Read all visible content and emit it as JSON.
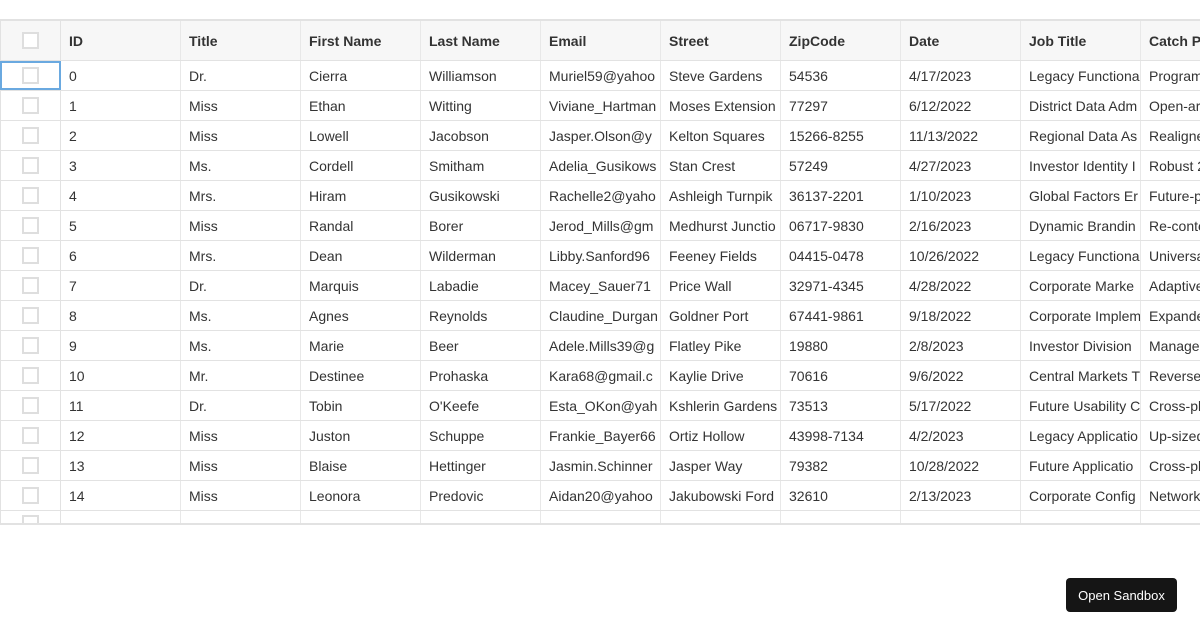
{
  "table": {
    "select_all_checked": false,
    "columns": [
      "ID",
      "Title",
      "First Name",
      "Last Name",
      "Email",
      "Street",
      "ZipCode",
      "Date",
      "Job Title",
      "Catch P"
    ],
    "rows": [
      [
        "0",
        "Dr.",
        "Cierra",
        "Williamson",
        "Muriel59@yahoo",
        "Steve Gardens",
        "54536",
        "4/17/2023",
        "Legacy Functiona",
        "Program"
      ],
      [
        "1",
        "Miss",
        "Ethan",
        "Witting",
        "Viviane_Hartman",
        "Moses Extension",
        "77297",
        "6/12/2022",
        "District Data Adm",
        "Open-ar"
      ],
      [
        "2",
        "Miss",
        "Lowell",
        "Jacobson",
        "Jasper.Olson@y",
        "Kelton Squares",
        "15266-8255",
        "11/13/2022",
        "Regional Data As",
        "Realigne"
      ],
      [
        "3",
        "Ms.",
        "Cordell",
        "Smitham",
        "Adelia_Gusikows",
        "Stan Crest",
        "57249",
        "4/27/2023",
        "Investor Identity I",
        "Robust 2"
      ],
      [
        "4",
        "Mrs.",
        "Hiram",
        "Gusikowski",
        "Rachelle2@yaho",
        "Ashleigh Turnpik",
        "36137-2201",
        "1/10/2023",
        "Global Factors Er",
        "Future-p"
      ],
      [
        "5",
        "Miss",
        "Randal",
        "Borer",
        "Jerod_Mills@gm",
        "Medhurst Junctio",
        "06717-9830",
        "2/16/2023",
        "Dynamic Brandin",
        "Re-conte"
      ],
      [
        "6",
        "Mrs.",
        "Dean",
        "Wilderman",
        "Libby.Sanford96",
        "Feeney Fields",
        "04415-0478",
        "10/26/2022",
        "Legacy Functiona",
        "Universa"
      ],
      [
        "7",
        "Dr.",
        "Marquis",
        "Labadie",
        "Macey_Sauer71",
        "Price Wall",
        "32971-4345",
        "4/28/2022",
        "Corporate Marke",
        "Adaptive"
      ],
      [
        "8",
        "Ms.",
        "Agnes",
        "Reynolds",
        "Claudine_Durgan",
        "Goldner Port",
        "67441-9861",
        "9/18/2022",
        "Corporate Implem",
        "Expande"
      ],
      [
        "9",
        "Ms.",
        "Marie",
        "Beer",
        "Adele.Mills39@g",
        "Flatley Pike",
        "19880",
        "2/8/2023",
        "Investor Division",
        "Manage"
      ],
      [
        "10",
        "Mr.",
        "Destinee",
        "Prohaska",
        "Kara68@gmail.c",
        "Kaylie Drive",
        "70616",
        "9/6/2022",
        "Central Markets T",
        "Reverse"
      ],
      [
        "11",
        "Dr.",
        "Tobin",
        "O'Keefe",
        "Esta_OKon@yah",
        "Kshlerin Gardens",
        "73513",
        "5/17/2022",
        "Future Usability C",
        "Cross-pl"
      ],
      [
        "12",
        "Miss",
        "Juston",
        "Schuppe",
        "Frankie_Bayer66",
        "Ortiz Hollow",
        "43998-7134",
        "4/2/2023",
        "Legacy Applicatio",
        "Up-sized"
      ],
      [
        "13",
        "Miss",
        "Blaise",
        "Hettinger",
        "Jasmin.Schinner",
        "Jasper Way",
        "79382",
        "10/28/2022",
        "Future Applicatio",
        "Cross-pl"
      ],
      [
        "14",
        "Miss",
        "Leonora",
        "Predovic",
        "Aidan20@yahoo",
        "Jakubowski Ford",
        "32610",
        "2/13/2023",
        "Corporate Config",
        "Network"
      ]
    ]
  },
  "footer": {
    "open_sandbox_label": "Open Sandbox"
  }
}
